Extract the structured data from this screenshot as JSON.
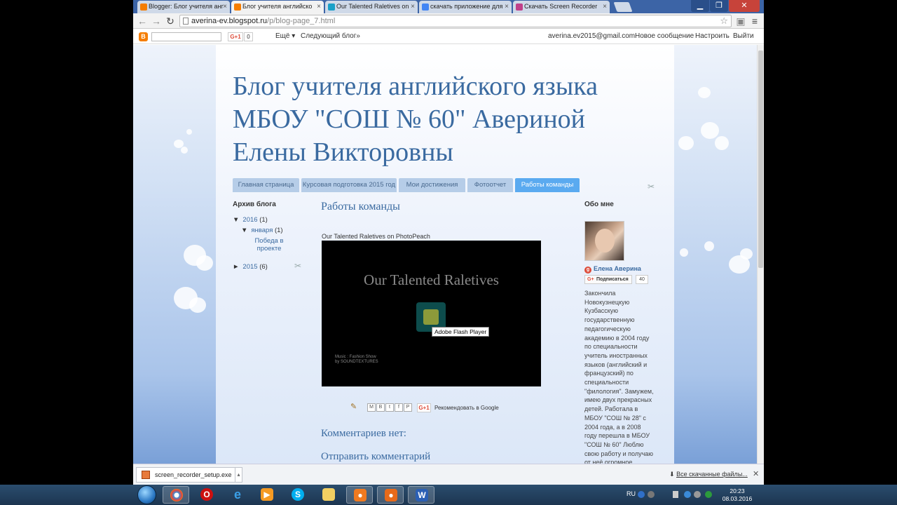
{
  "browser": {
    "tabs": [
      {
        "label": "Blogger: Блог учителя анг",
        "favicon_color": "#f57d00"
      },
      {
        "label": "Блог учителя английско",
        "favicon_color": "#f57d00"
      },
      {
        "label": "Our Talented Raletives on",
        "favicon_color": "#1aa0c8"
      },
      {
        "label": "скачать приложение для",
        "favicon_color": "#4285f4"
      },
      {
        "label": "Скачать Screen Recorder",
        "favicon_color": "#c0408a"
      }
    ],
    "url": {
      "host": "averina-ev.blogspot.ru",
      "path": "/p/blog-page_7.html"
    }
  },
  "bloggerbar": {
    "gplus_label": "G+1",
    "gplus_count": "0",
    "more": "Ещё ▾",
    "next_blog": "Следующий блог»",
    "email": "averina.ev2015@gmail.com",
    "new_post": "Новое сообщение",
    "customize": "Настроить",
    "logout": "Выйти"
  },
  "blog": {
    "title": "Блог учителя английского языка МБОУ \"СОШ № 60\" Авериной Елены Викторовны",
    "nav_tabs": [
      "Главная страница",
      "Курсовая подготовка 2015 год",
      "Мои достижения",
      "Фотоотчет",
      "Работы команды"
    ],
    "active_tab": "Работы команды"
  },
  "archive": {
    "heading": "Архив блога",
    "year_2016": {
      "label": "2016",
      "count": "(1)",
      "toggle": "▼"
    },
    "month": {
      "label": "января",
      "count": "(1)",
      "toggle": "▼"
    },
    "post": "Победа в проекте",
    "year_2015": {
      "label": "2015",
      "count": "(6)",
      "toggle": "►"
    }
  },
  "post": {
    "title": "Работы команды",
    "video_caption": "Our Talented Raletives on PhotoPeach",
    "video_title": "Our Talented Raletives",
    "flash_tooltip": "Adobe Flash Player",
    "music_credit": "Music : Fashion Show\nby SOUNDTEXTURES",
    "share_buttons": [
      "M",
      "B",
      "t",
      "f",
      "P"
    ],
    "gplus_label": "G+1",
    "recommend": "Рекомендовать в Google",
    "no_comments": "Комментариев нет:",
    "post_comment": "Отправить комментарий"
  },
  "profile": {
    "heading": "Обо мне",
    "name": "Елена Аверина",
    "follow": "Подписаться",
    "followers": "40",
    "bio": "Закончила\nНовокузнецкую\nКузбасскую\nгосударственную\nпедагогическую\nакадемию в 2004 году\nпо специальности\nучитель иностранных\nязыков (английский и\nфранцузский) по\nспециальности\n\"филология\". Замужем,\nимею двух прекрасных\nдетей. Работала в\nМБОУ \"СОШ № 28\" с\n2004 года, а в 2008\nгоду перешла в МБОУ\n \"СОШ № 60\" Люблю\nсвою работу и получаю\nот неё огромное"
  },
  "downloads": {
    "file": "screen_recorder_setup.exe",
    "show_all": "Все скачанные файлы..."
  },
  "taskbar": {
    "lang": "RU",
    "time": "20:23",
    "date": "08.03.2016"
  }
}
